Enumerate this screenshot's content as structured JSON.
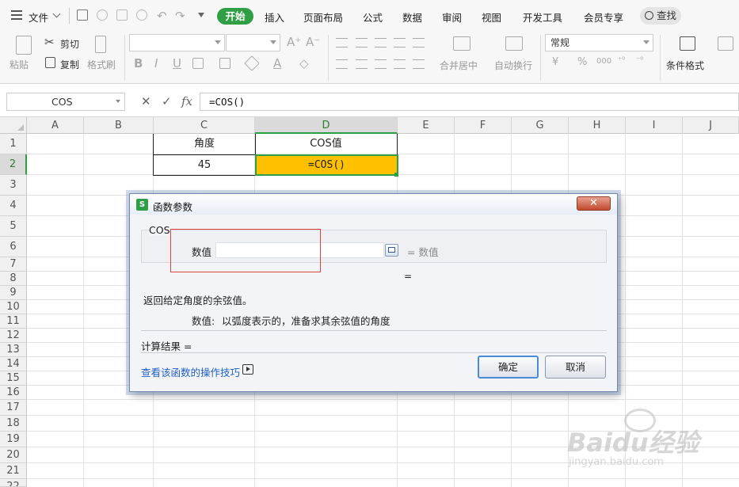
{
  "menu": {
    "file": "文件",
    "tabs": [
      "开始",
      "插入",
      "页面布局",
      "公式",
      "数据",
      "审阅",
      "视图",
      "开发工具",
      "会员专享"
    ],
    "search": "查找"
  },
  "ribbon": {
    "paste": "粘贴",
    "cut": "剪切",
    "copy": "复制",
    "format_painter": "格式刷",
    "merge_center": "合并居中",
    "wrap_text": "自动换行",
    "number_format": "常规",
    "conditional_format": "条件格式",
    "font_buttons": [
      "B",
      "I",
      "U"
    ],
    "number_symbols": [
      "¥",
      "%",
      "000"
    ]
  },
  "formula_bar": {
    "name_box": "COS",
    "cancel": "✕",
    "enter": "✓",
    "fx": "fx",
    "formula": "=COS()"
  },
  "sheet": {
    "columns": [
      "A",
      "B",
      "C",
      "D",
      "E",
      "F",
      "G",
      "H",
      "I",
      "J"
    ],
    "rows": [
      "1",
      "2",
      "3",
      "4",
      "5",
      "6",
      "7",
      "8",
      "9",
      "10",
      "11",
      "12",
      "13",
      "14",
      "15",
      "16",
      "17",
      "18",
      "19",
      "20",
      "21",
      "22"
    ],
    "selected_column": "D",
    "selected_row": "2",
    "cells": {
      "C1": "角度",
      "D1": "COS值",
      "C2": "45",
      "D2": "=COS()"
    },
    "selected_cell_fill": "#ffc000"
  },
  "dialog": {
    "title": "函数参数",
    "close": "✕",
    "function_name": "COS",
    "arg_label": "数值",
    "arg_value": "",
    "arg_result": "= 数值",
    "eq_line": "=",
    "description": "返回给定角度的余弦值。",
    "arg_help_label": "数值:",
    "arg_help_text": "以弧度表示的，准备求其余弦值的角度",
    "result_label": "计算结果  =",
    "tips_link": "查看该函数的操作技巧",
    "ok": "确定",
    "cancel": "取消"
  },
  "watermark": {
    "brand": "Baidu经验",
    "url": "jingyan.baidu.com"
  },
  "colors": {
    "accent_green": "#2f9e44",
    "selection_orange": "#ffc000",
    "highlight_red": "#e0403a"
  }
}
